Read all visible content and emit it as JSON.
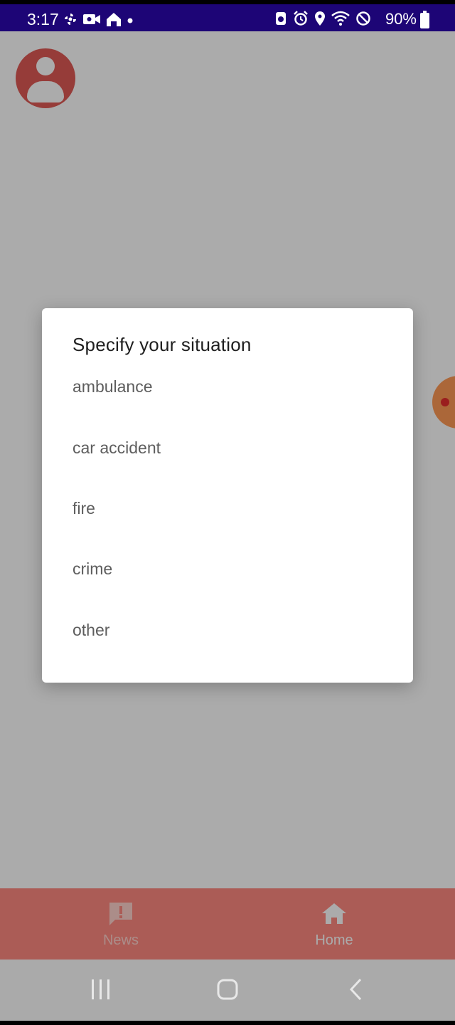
{
  "status_bar": {
    "time": "3:17",
    "battery": "90%",
    "left_icons": [
      "pinwheel-icon",
      "video-call-icon",
      "home-outline-icon",
      "dot-icon"
    ],
    "right_icons": [
      "android-icon",
      "alarm-icon",
      "location-icon",
      "wifi-icon",
      "do-not-disturb-icon",
      "battery-icon"
    ]
  },
  "dialog": {
    "title": "Specify your situation",
    "options": [
      "ambulance",
      "car accident",
      "fire",
      "crime",
      "other"
    ]
  },
  "bottom_nav": {
    "items": [
      {
        "label": "News",
        "icon": "news-alert-icon"
      },
      {
        "label": "Home",
        "icon": "home-icon"
      }
    ]
  },
  "system_nav": [
    "recents-button",
    "home-button",
    "back-button"
  ],
  "colors": {
    "status_bar": "#1d0576",
    "accent": "#ff8a80",
    "avatar": "#e05a56",
    "scrim": "rgba(0,0,0,0.33)"
  }
}
